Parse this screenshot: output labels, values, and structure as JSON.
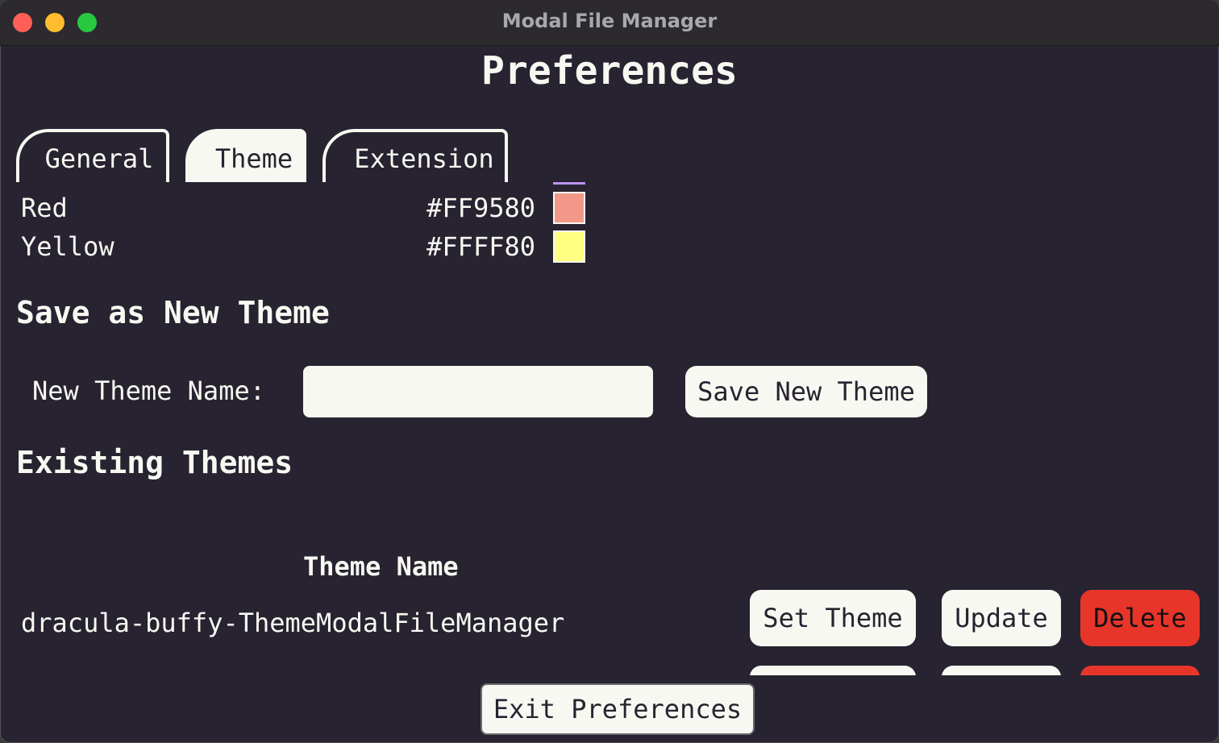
{
  "window": {
    "title": "Modal File Manager"
  },
  "page": {
    "title": "Preferences"
  },
  "tabs": [
    {
      "label": "General",
      "active": false
    },
    {
      "label": "Theme",
      "active": true
    },
    {
      "label": "Extension",
      "active": false
    }
  ],
  "colors": [
    {
      "name": "Red",
      "hex": "#FF9580"
    },
    {
      "name": "Yellow",
      "hex": "#FFFF80"
    }
  ],
  "save_section": {
    "heading": "Save as New Theme",
    "name_label": "New Theme Name:",
    "name_value": "",
    "save_button": "Save New Theme"
  },
  "existing_section": {
    "heading": "Existing Themes",
    "column_header": "Theme Name",
    "rows": [
      {
        "name": "dracula-buffy-ThemeModalFileManager",
        "set_label": "Set Theme",
        "update_label": "Update",
        "delete_label": "Delete"
      }
    ]
  },
  "footer": {
    "exit_button": "Exit Preferences"
  },
  "palette": {
    "background": "#282330",
    "foreground": "#F8F8F2",
    "delete": "#E8352A",
    "scroll_accent": "#BD93F9"
  }
}
